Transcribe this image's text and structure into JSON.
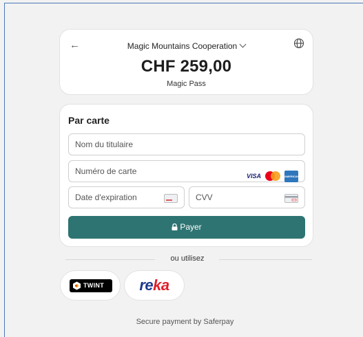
{
  "header": {
    "back_icon": "arrow-left-icon",
    "merchant": "Magic Mountains Cooperation",
    "language_icon": "globe-icon",
    "amount": "CHF 259,00",
    "product": "Magic Pass"
  },
  "form": {
    "title": "Par carte",
    "cardholder_placeholder": "Nom du titulaire",
    "card_number_placeholder": "Numéro de carte",
    "expiry_placeholder": "Date d'expiration",
    "cvv_placeholder": "CVV",
    "brands": {
      "visa": "VISA",
      "amex": "AMERICAN EXPRESS"
    },
    "pay_label": "Payer",
    "pay_color": "#2d7472"
  },
  "alternatives": {
    "divider_label": "ou utilisez",
    "twint_label": "TWINT",
    "reka_re": "re",
    "reka_ka": "ka"
  },
  "footer": "Secure payment by Saferpay"
}
